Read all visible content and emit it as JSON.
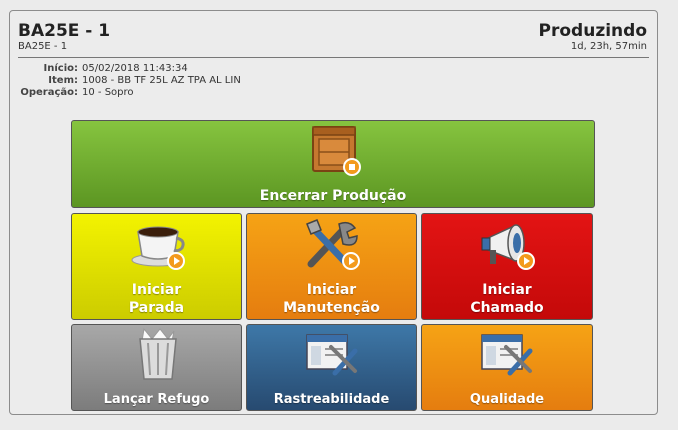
{
  "header": {
    "title": "BA25E - 1",
    "subtitle": "BA25E - 1",
    "status": "Produzindo",
    "status_time": "1d, 23h, 57min"
  },
  "info": [
    {
      "key": "Início:",
      "value": "05/02/2018 11:43:34"
    },
    {
      "key": "Item:",
      "value": "1008 - BB TF 25L AZ TPA AL LIN"
    },
    {
      "key": "Operação:",
      "value": "10 - Sopro"
    }
  ],
  "actions": {
    "end_production": "Encerrar Produção",
    "start_stop_line1": "Iniciar",
    "start_stop_line2": "Parada",
    "start_maint_line1": "Iniciar",
    "start_maint_line2": "Manutenção",
    "start_call_line1": "Iniciar",
    "start_call_line2": "Chamado",
    "scrap": "Lançar Refugo",
    "traceability": "Rastreabilidade",
    "quality": "Qualidade"
  },
  "icons": {
    "end_production": "box-icon",
    "stop": "coffee-cup-icon",
    "maintenance": "tools-icon",
    "call": "megaphone-icon",
    "scrap": "trash-bin-icon",
    "traceability": "window-tools-icon",
    "quality": "window-tools-icon"
  },
  "colors": {
    "green": "#6aa52b",
    "yellow": "#e2e400",
    "orange": "#ee8c10",
    "red": "#d40b0b",
    "gray": "#8f8f8f",
    "blue": "#2f5e8c"
  }
}
